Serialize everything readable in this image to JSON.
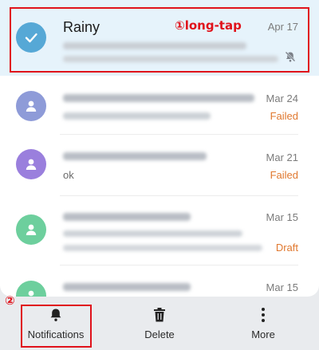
{
  "colors": {
    "accent_blue": "#56a8d6",
    "status_orange": "#e0782f",
    "annotation_red": "#e0121b"
  },
  "conversations": [
    {
      "name": "Rainy",
      "date": "Apr 17",
      "status": "",
      "preview": "",
      "avatar_color": "#56a8d6",
      "avatar_icon": "check-icon",
      "selected": true,
      "muted": true
    },
    {
      "name": "",
      "date": "Mar 24",
      "status": "Failed",
      "preview": "",
      "avatar_color": "#8e9bd8",
      "avatar_icon": "person-icon",
      "selected": false,
      "muted": false
    },
    {
      "name": "",
      "date": "Mar 21",
      "status": "Failed",
      "preview": "ok",
      "avatar_color": "#9a7fdd",
      "avatar_icon": "person-icon",
      "selected": false,
      "muted": false
    },
    {
      "name": "",
      "date": "Mar 15",
      "status": "Draft",
      "preview": "",
      "avatar_color": "#6dcf9d",
      "avatar_icon": "person-icon",
      "selected": false,
      "muted": false
    },
    {
      "name": "",
      "date": "Mar 15",
      "status": "",
      "preview": "",
      "avatar_color": "#6dcf9d",
      "avatar_icon": "person-icon",
      "selected": false,
      "muted": false
    }
  ],
  "annotations": {
    "step1": "①long-tap",
    "step2": "②"
  },
  "toolbar": {
    "notifications_label": "Notifications",
    "notifications_icon": "bell-icon",
    "delete_label": "Delete",
    "delete_icon": "trash-icon",
    "more_label": "More",
    "more_icon": "more-vertical-icon"
  }
}
